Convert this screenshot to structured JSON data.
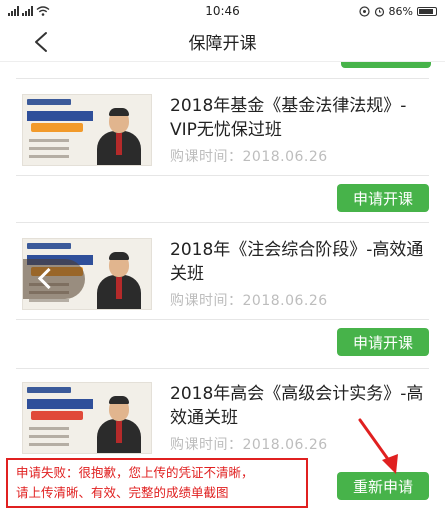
{
  "status_bar": {
    "time": "10:46",
    "battery_text": "86%"
  },
  "nav": {
    "title": "保障开课",
    "back_icon": "chevron-left-icon"
  },
  "courses": [
    {
      "title": "2018年基金《基金法律法规》-VIP无忧保过班",
      "time_label": "购课时间：2018.06.26",
      "button_label": "申请开课"
    },
    {
      "title": "2018年《注会综合阶段》-高效通关班",
      "time_label": "购课时间：2018.06.26",
      "button_label": "申请开课"
    },
    {
      "title": "2018年高会《高级会计实务》-高效通关班",
      "time_label": "购课时间：2018.06.26",
      "button_label": "重新申请"
    }
  ],
  "error_message": {
    "line1": "申请失败：很抱歉，您上传的凭证不清晰，",
    "line2": "请上传清晰、有效、完整的成绩单截图"
  },
  "colors": {
    "accent_green": "#47b34a",
    "error_red": "#e02020"
  }
}
